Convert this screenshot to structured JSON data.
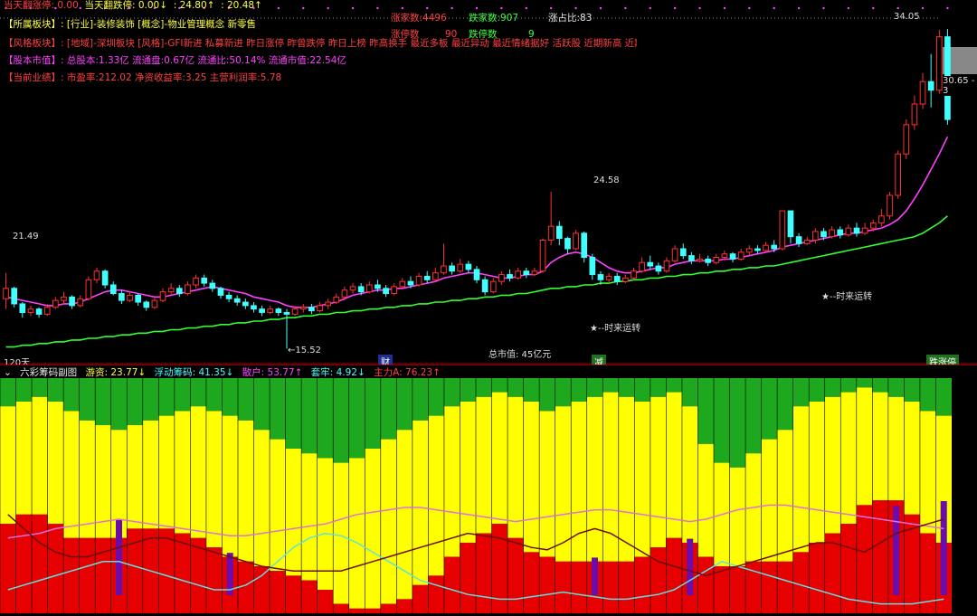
{
  "top_status": {
    "limit_up_today": "当天翻涨停: 0.00",
    "limit_down_today": "当天翻跌停: 0.00↓",
    "val1": ": 24.80↑",
    "val2": ": 20.48↑"
  },
  "market_stats": {
    "rise_count": "涨家数:4496",
    "fall_count": "跌家数:907",
    "rise_ratio": "涨占比:83",
    "limit_up_label": "涨停数",
    "limit_up_value": "90",
    "limit_down_label": "跌停数",
    "limit_down_value": "9"
  },
  "info": {
    "sector": {
      "label": "【所属板块】:",
      "value": "[行业]-装修装饰 [概念]-物业管理概念 新零售"
    },
    "style": {
      "label": "【风格板块】:",
      "value": "[地域]-深圳板块 [风格]-GFI新进 私募新进 昨日涨停 昨曾跌停 昨日上榜 昨高换手 最近多板 最近异动 最近情绪据好 活跃股 近期新高 近期强势 活跃小盘来融"
    },
    "equity": {
      "label": "【股本市值】:",
      "value": "总股本:1.33亿 流通盘:0.67亿 流通比:50.14% 流通市值:22.54亿"
    },
    "finance": {
      "label": "【当前业绩】:",
      "value": "市盈率:212.02 净资收益率:3.25 主营利润率:5.78"
    }
  },
  "price_labels": {
    "high_left": "21.49",
    "low": "←15.52",
    "mid_peak": "24.58",
    "top_right": "34.05",
    "right_axis": "30.65 - 3",
    "period": "120天",
    "market_cap": "总市值: 45亿元",
    "signal1": "★--时来运转",
    "signal2": "★--时来运转",
    "marker_cai": "财",
    "marker_jian": "减",
    "marker_limit": "跌涨停"
  },
  "sub_header": {
    "title": "六彩筹码副图",
    "youzi": "游资: 23.77↓",
    "fudong": "浮动筹码: 41.35↓",
    "sanhu": "散户: 53.77↑",
    "taolao": "套牢: 4.92↓",
    "zhuli": "主力A: 76.23↑"
  },
  "colors": {
    "up": "#ff3030",
    "down": "#40ffff",
    "ma_short": "#ff40ff",
    "ma_long": "#30ff30",
    "chip_green": "#1ea81e",
    "chip_yellow": "#ffff00",
    "chip_red": "#e60000",
    "chip_purple": "#6a0dad"
  },
  "chart_data": {
    "type": "candlestick",
    "candles_ohlc": [
      [
        18.4,
        19.0,
        17.8,
        19.9
      ],
      [
        19.0,
        18.1,
        17.9,
        19.1
      ],
      [
        18.1,
        17.6,
        17.3,
        18.2
      ],
      [
        17.6,
        17.8,
        17.4,
        18.0
      ],
      [
        17.8,
        17.5,
        17.3,
        17.9
      ],
      [
        17.5,
        17.9,
        17.4,
        18.1
      ],
      [
        17.9,
        18.3,
        17.8,
        18.5
      ],
      [
        18.3,
        18.5,
        18.1,
        18.8
      ],
      [
        18.5,
        18.0,
        17.8,
        18.6
      ],
      [
        18.0,
        18.4,
        17.9,
        18.6
      ],
      [
        18.4,
        19.5,
        18.3,
        19.7
      ],
      [
        19.5,
        20.0,
        19.3,
        20.2
      ],
      [
        20.0,
        19.2,
        19.0,
        20.1
      ],
      [
        19.2,
        18.7,
        18.6,
        19.4
      ],
      [
        18.7,
        18.3,
        18.1,
        18.9
      ],
      [
        18.3,
        18.6,
        18.2,
        18.8
      ],
      [
        18.6,
        18.2,
        18.0,
        18.7
      ],
      [
        18.2,
        17.9,
        17.7,
        18.3
      ],
      [
        17.9,
        18.3,
        17.8,
        18.5
      ],
      [
        18.3,
        18.8,
        18.2,
        19.0
      ],
      [
        18.8,
        19.0,
        18.6,
        19.3
      ],
      [
        19.0,
        18.7,
        18.5,
        19.2
      ],
      [
        18.7,
        19.2,
        18.6,
        19.4
      ],
      [
        19.2,
        19.6,
        19.0,
        19.8
      ],
      [
        19.6,
        19.3,
        19.1,
        19.8
      ],
      [
        19.3,
        19.0,
        18.8,
        19.5
      ],
      [
        19.0,
        18.6,
        18.4,
        19.1
      ],
      [
        18.6,
        18.4,
        18.2,
        18.8
      ],
      [
        18.4,
        18.2,
        18.0,
        18.6
      ],
      [
        18.2,
        18.0,
        17.8,
        18.4
      ],
      [
        18.0,
        17.8,
        17.6,
        18.2
      ],
      [
        17.8,
        17.6,
        17.4,
        18.0
      ],
      [
        17.6,
        17.8,
        17.5,
        18.0
      ],
      [
        17.8,
        17.6,
        17.4,
        17.9
      ],
      [
        17.6,
        17.5,
        15.5,
        17.8
      ],
      [
        17.5,
        17.8,
        17.4,
        18.0
      ],
      [
        17.8,
        17.9,
        17.6,
        18.1
      ],
      [
        17.9,
        17.7,
        17.5,
        18.1
      ],
      [
        17.7,
        18.0,
        17.6,
        18.2
      ],
      [
        18.0,
        18.2,
        17.8,
        18.4
      ],
      [
        18.2,
        18.5,
        18.1,
        18.7
      ],
      [
        18.5,
        18.9,
        18.3,
        19.1
      ],
      [
        18.9,
        19.1,
        18.7,
        19.3
      ],
      [
        19.1,
        18.8,
        18.6,
        19.3
      ],
      [
        18.8,
        19.2,
        18.7,
        19.4
      ],
      [
        19.2,
        19.0,
        18.8,
        19.5
      ],
      [
        19.0,
        18.7,
        18.5,
        19.2
      ],
      [
        18.7,
        19.1,
        18.6,
        19.3
      ],
      [
        19.1,
        19.4,
        19.0,
        19.6
      ],
      [
        19.4,
        19.2,
        19.0,
        19.7
      ],
      [
        19.2,
        19.7,
        19.1,
        19.9
      ],
      [
        19.7,
        19.5,
        19.3,
        20.0
      ],
      [
        19.5,
        19.9,
        19.4,
        20.2
      ],
      [
        19.9,
        20.3,
        19.8,
        21.6
      ],
      [
        20.3,
        20.0,
        19.8,
        20.5
      ],
      [
        20.0,
        20.4,
        19.9,
        20.7
      ],
      [
        20.4,
        20.1,
        19.9,
        20.6
      ],
      [
        20.1,
        19.5,
        19.3,
        20.3
      ],
      [
        19.5,
        18.8,
        18.6,
        19.7
      ],
      [
        18.8,
        19.4,
        18.7,
        19.6
      ],
      [
        19.4,
        19.8,
        19.2,
        20.0
      ],
      [
        19.8,
        19.6,
        19.4,
        20.1
      ],
      [
        19.6,
        20.0,
        19.5,
        20.2
      ],
      [
        20.0,
        19.8,
        19.6,
        20.2
      ],
      [
        19.8,
        20.0,
        19.7,
        20.2
      ],
      [
        20.0,
        21.8,
        19.9,
        21.9
      ],
      [
        21.8,
        22.6,
        21.5,
        24.6
      ],
      [
        22.6,
        21.9,
        21.5,
        22.9
      ],
      [
        21.9,
        21.3,
        21.0,
        22.0
      ],
      [
        21.3,
        22.2,
        21.2,
        22.4
      ],
      [
        22.2,
        20.8,
        20.5,
        22.3
      ],
      [
        20.8,
        19.8,
        19.5,
        21.0
      ],
      [
        19.8,
        19.5,
        19.2,
        20.0
      ],
      [
        19.5,
        19.7,
        19.3,
        19.9
      ],
      [
        19.7,
        19.4,
        19.2,
        19.9
      ],
      [
        19.4,
        19.6,
        19.3,
        19.8
      ],
      [
        19.6,
        20.0,
        19.5,
        20.2
      ],
      [
        20.0,
        20.5,
        19.9,
        20.8
      ],
      [
        20.5,
        20.3,
        20.1,
        20.9
      ],
      [
        20.3,
        20.0,
        19.8,
        20.5
      ],
      [
        20.0,
        20.6,
        19.9,
        20.8
      ],
      [
        20.6,
        21.3,
        20.5,
        21.5
      ],
      [
        21.3,
        20.9,
        20.7,
        21.6
      ],
      [
        20.9,
        20.6,
        20.4,
        21.1
      ],
      [
        20.6,
        20.7,
        20.5,
        21.0
      ],
      [
        20.7,
        20.5,
        20.3,
        20.9
      ],
      [
        20.5,
        20.8,
        20.4,
        21.0
      ],
      [
        20.8,
        21.0,
        20.6,
        21.2
      ],
      [
        21.0,
        20.7,
        20.5,
        21.1
      ],
      [
        20.7,
        21.1,
        20.6,
        21.3
      ],
      [
        21.1,
        21.3,
        20.9,
        21.5
      ],
      [
        21.3,
        21.2,
        21.0,
        21.5
      ],
      [
        21.2,
        21.5,
        21.1,
        21.7
      ],
      [
        21.5,
        21.3,
        21.1,
        21.8
      ],
      [
        21.3,
        23.5,
        21.2,
        23.5
      ],
      [
        23.5,
        22.0,
        21.6,
        23.5
      ],
      [
        22.0,
        21.6,
        21.4,
        22.2
      ],
      [
        21.6,
        21.8,
        21.5,
        22.0
      ],
      [
        21.8,
        22.3,
        21.6,
        22.5
      ],
      [
        22.3,
        22.0,
        21.8,
        22.5
      ],
      [
        22.0,
        22.4,
        21.9,
        22.6
      ],
      [
        22.4,
        22.1,
        21.9,
        22.6
      ],
      [
        22.1,
        22.5,
        22.0,
        22.7
      ],
      [
        22.5,
        22.2,
        22.0,
        22.8
      ],
      [
        22.2,
        22.5,
        22.1,
        22.8
      ],
      [
        22.5,
        22.8,
        22.3,
        23.0
      ],
      [
        22.8,
        23.2,
        22.6,
        23.6
      ],
      [
        23.2,
        24.4,
        23.0,
        24.6
      ],
      [
        24.4,
        26.8,
        24.2,
        27.0
      ],
      [
        26.8,
        28.5,
        26.5,
        28.8
      ],
      [
        28.5,
        29.7,
        28.2,
        30.2
      ],
      [
        29.7,
        31.0,
        29.4,
        31.5
      ],
      [
        31.0,
        30.5,
        29.5,
        32.6
      ],
      [
        30.5,
        33.6,
        30.3,
        34.0
      ],
      [
        33.6,
        28.8,
        28.5,
        34.05
      ]
    ],
    "ma_short": [
      18.5,
      18.4,
      18.3,
      18.2,
      18.1,
      18.0,
      18.0,
      18.1,
      18.1,
      18.2,
      18.4,
      18.6,
      18.8,
      18.9,
      18.9,
      18.8,
      18.7,
      18.6,
      18.5,
      18.5,
      18.6,
      18.7,
      18.8,
      18.9,
      19.0,
      19.1,
      19.0,
      18.9,
      18.8,
      18.7,
      18.5,
      18.4,
      18.3,
      18.2,
      18.0,
      17.9,
      17.9,
      17.9,
      18.0,
      18.1,
      18.2,
      18.4,
      18.6,
      18.7,
      18.8,
      18.9,
      18.9,
      19.0,
      19.0,
      19.1,
      19.2,
      19.3,
      19.4,
      19.6,
      19.7,
      19.8,
      19.9,
      19.9,
      19.8,
      19.7,
      19.6,
      19.6,
      19.7,
      19.8,
      19.8,
      20.0,
      20.5,
      20.8,
      21.0,
      21.1,
      21.0,
      20.8,
      20.5,
      20.2,
      20.0,
      19.9,
      19.9,
      20.0,
      20.1,
      20.2,
      20.2,
      20.4,
      20.5,
      20.6,
      20.6,
      20.6,
      20.6,
      20.7,
      20.7,
      20.8,
      20.9,
      21.0,
      21.1,
      21.2,
      21.4,
      21.5,
      21.6,
      21.7,
      21.8,
      21.9,
      22.0,
      22.1,
      22.2,
      22.2,
      22.3,
      22.4,
      22.5,
      22.7,
      23.0,
      23.5,
      24.2,
      25.0,
      25.9,
      26.8,
      27.8
    ],
    "ma_long": [
      15.6,
      15.6,
      15.7,
      15.7,
      15.8,
      15.8,
      15.9,
      15.9,
      16.0,
      16.0,
      16.1,
      16.1,
      16.2,
      16.2,
      16.3,
      16.3,
      16.4,
      16.4,
      16.5,
      16.5,
      16.6,
      16.6,
      16.7,
      16.7,
      16.8,
      16.8,
      16.9,
      16.9,
      17.0,
      17.0,
      17.1,
      17.1,
      17.2,
      17.2,
      17.3,
      17.3,
      17.4,
      17.4,
      17.5,
      17.5,
      17.6,
      17.6,
      17.7,
      17.7,
      17.8,
      17.8,
      17.9,
      17.9,
      18.0,
      18.0,
      18.1,
      18.1,
      18.2,
      18.2,
      18.3,
      18.3,
      18.4,
      18.4,
      18.5,
      18.5,
      18.6,
      18.6,
      18.7,
      18.7,
      18.8,
      18.9,
      19.0,
      19.0,
      19.1,
      19.1,
      19.2,
      19.2,
      19.3,
      19.3,
      19.4,
      19.4,
      19.5,
      19.5,
      19.6,
      19.6,
      19.7,
      19.7,
      19.8,
      19.8,
      19.9,
      19.9,
      20.0,
      20.0,
      20.1,
      20.1,
      20.2,
      20.2,
      20.3,
      20.3,
      20.4,
      20.5,
      20.6,
      20.7,
      20.8,
      20.9,
      21.0,
      21.1,
      21.2,
      21.3,
      21.4,
      21.5,
      21.6,
      21.7,
      21.8,
      21.9,
      22.0,
      22.2,
      22.5,
      22.8,
      23.2
    ],
    "y_range": [
      15.0,
      35.0
    ],
    "chips": {
      "green_pct": [
        12,
        10,
        8,
        10,
        14,
        18,
        20,
        22,
        20,
        18,
        16,
        14,
        12,
        14,
        16,
        18,
        22,
        26,
        30,
        32,
        34,
        36,
        34,
        30,
        26,
        22,
        18,
        16,
        12,
        10,
        8,
        6,
        8,
        10,
        14,
        12,
        10,
        8,
        6,
        8,
        10,
        8,
        6,
        12,
        28,
        36,
        38,
        32,
        26,
        22,
        12,
        10,
        8,
        6,
        4,
        6,
        8,
        10,
        14,
        16
      ],
      "yellow_pct": [
        50,
        48,
        50,
        52,
        54,
        50,
        48,
        46,
        44,
        46,
        48,
        52,
        56,
        58,
        60,
        60,
        58,
        56,
        54,
        54,
        56,
        60,
        64,
        68,
        70,
        72,
        70,
        68,
        64,
        60,
        58,
        56,
        60,
        64,
        62,
        66,
        68,
        70,
        72,
        70,
        66,
        64,
        62,
        58,
        48,
        44,
        42,
        46,
        52,
        56,
        62,
        60,
        58,
        56,
        50,
        46,
        44,
        48,
        52,
        54
      ],
      "purple_pct": [
        0,
        0,
        0,
        0,
        0,
        0,
        0,
        32,
        0,
        0,
        0,
        0,
        0,
        0,
        18,
        0,
        0,
        0,
        0,
        0,
        0,
        0,
        0,
        0,
        0,
        0,
        0,
        0,
        0,
        0,
        0,
        0,
        0,
        0,
        0,
        0,
        0,
        16,
        0,
        0,
        0,
        0,
        0,
        24,
        0,
        0,
        0,
        0,
        0,
        0,
        0,
        0,
        0,
        0,
        0,
        0,
        38,
        0,
        0,
        40
      ],
      "line_magenta": [
        32,
        33,
        34,
        36,
        37,
        38,
        39,
        40,
        39,
        38,
        37,
        36,
        35,
        34,
        33,
        33,
        34,
        35,
        36,
        37,
        38,
        40,
        42,
        43,
        44,
        45,
        45,
        44,
        43,
        42,
        41,
        40,
        39,
        40,
        41,
        42,
        43,
        44,
        44,
        43,
        42,
        41,
        40,
        39,
        40,
        42,
        44,
        45,
        46,
        46,
        45,
        44,
        43,
        42,
        41,
        40,
        39,
        38,
        37,
        36
      ],
      "line_cyan": [
        10,
        12,
        14,
        16,
        18,
        20,
        22,
        22,
        20,
        18,
        16,
        14,
        12,
        10,
        10,
        12,
        16,
        22,
        28,
        32,
        34,
        33,
        30,
        26,
        22,
        18,
        14,
        12,
        10,
        8,
        7,
        6,
        6,
        7,
        8,
        9,
        8,
        7,
        6,
        6,
        7,
        8,
        10,
        14,
        18,
        22,
        20,
        18,
        16,
        14,
        12,
        10,
        8,
        6,
        5,
        4,
        4,
        4,
        5,
        6
      ],
      "line_darkred": [
        42,
        36,
        30,
        26,
        24,
        24,
        26,
        28,
        30,
        32,
        32,
        30,
        28,
        26,
        24,
        22,
        20,
        19,
        18,
        18,
        18,
        18,
        20,
        22,
        24,
        26,
        28,
        30,
        32,
        34,
        33,
        32,
        30,
        28,
        27,
        30,
        34,
        36,
        34,
        30,
        26,
        22,
        20,
        18,
        16,
        18,
        20,
        22,
        24,
        26,
        28,
        30,
        30,
        28,
        26,
        30,
        34,
        36,
        38,
        40
      ]
    }
  }
}
